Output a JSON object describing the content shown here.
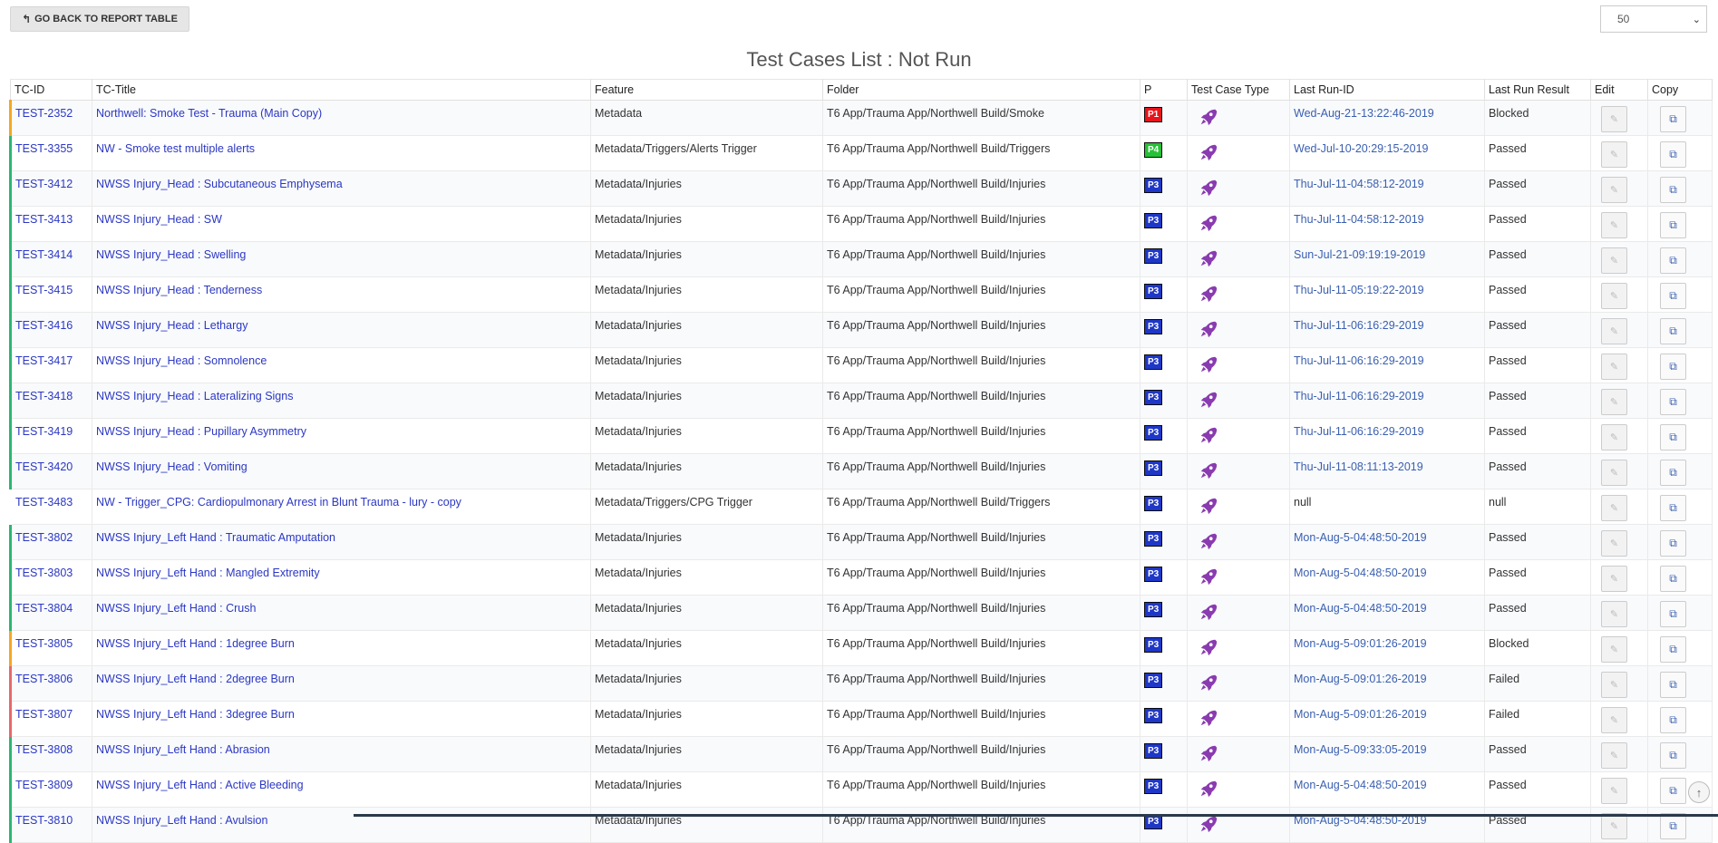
{
  "toolbar": {
    "back_label": "GO BACK TO REPORT TABLE",
    "back_icon": "reply-arrow-icon",
    "page_size_value": "50"
  },
  "page_title": "Test Cases List : Not Run",
  "columns": [
    "TC-ID",
    "TC-Title",
    "Feature",
    "Folder",
    "P",
    "Test Case Type",
    "Last Run-ID",
    "Last Run Result",
    "Edit",
    "Copy"
  ],
  "colors": {
    "link": "#2b37c4",
    "passed_stripe": "#2bb673",
    "blocked_stripe": "#f5a623",
    "failed_stripe": "#e8676b",
    "p1": "#e8141b",
    "p3": "#1f37c7",
    "p4": "#25c136",
    "rocket": "#8a3bb0"
  },
  "rows": [
    {
      "id": "TEST-2352",
      "title": "Northwell: Smoke Test - Trauma (Main Copy)",
      "feature": "Metadata",
      "folder": "T6 App/Trauma App/Northwell Build/Smoke",
      "priority": "P1",
      "last_run_id": "Wed-Aug-21-13:22:46-2019",
      "result": "Blocked"
    },
    {
      "id": "TEST-3355",
      "title": "NW - Smoke test multiple alerts",
      "feature": "Metadata/Triggers/Alerts Trigger",
      "folder": "T6 App/Trauma App/Northwell Build/Triggers",
      "priority": "P4",
      "last_run_id": "Wed-Jul-10-20:29:15-2019",
      "result": "Passed"
    },
    {
      "id": "TEST-3412",
      "title": "NWSS Injury_Head : Subcutaneous Emphysema",
      "feature": "Metadata/Injuries",
      "folder": "T6 App/Trauma App/Northwell Build/Injuries",
      "priority": "P3",
      "last_run_id": "Thu-Jul-11-04:58:12-2019",
      "result": "Passed"
    },
    {
      "id": "TEST-3413",
      "title": "NWSS Injury_Head : SW",
      "feature": "Metadata/Injuries",
      "folder": "T6 App/Trauma App/Northwell Build/Injuries",
      "priority": "P3",
      "last_run_id": "Thu-Jul-11-04:58:12-2019",
      "result": "Passed"
    },
    {
      "id": "TEST-3414",
      "title": "NWSS Injury_Head : Swelling",
      "feature": "Metadata/Injuries",
      "folder": "T6 App/Trauma App/Northwell Build/Injuries",
      "priority": "P3",
      "last_run_id": "Sun-Jul-21-09:19:19-2019",
      "result": "Passed"
    },
    {
      "id": "TEST-3415",
      "title": "NWSS Injury_Head : Tenderness",
      "feature": "Metadata/Injuries",
      "folder": "T6 App/Trauma App/Northwell Build/Injuries",
      "priority": "P3",
      "last_run_id": "Thu-Jul-11-05:19:22-2019",
      "result": "Passed"
    },
    {
      "id": "TEST-3416",
      "title": "NWSS Injury_Head : Lethargy",
      "feature": "Metadata/Injuries",
      "folder": "T6 App/Trauma App/Northwell Build/Injuries",
      "priority": "P3",
      "last_run_id": "Thu-Jul-11-06:16:29-2019",
      "result": "Passed"
    },
    {
      "id": "TEST-3417",
      "title": "NWSS Injury_Head : Somnolence",
      "feature": "Metadata/Injuries",
      "folder": "T6 App/Trauma App/Northwell Build/Injuries",
      "priority": "P3",
      "last_run_id": "Thu-Jul-11-06:16:29-2019",
      "result": "Passed"
    },
    {
      "id": "TEST-3418",
      "title": "NWSS Injury_Head : Lateralizing Signs",
      "feature": "Metadata/Injuries",
      "folder": "T6 App/Trauma App/Northwell Build/Injuries",
      "priority": "P3",
      "last_run_id": "Thu-Jul-11-06:16:29-2019",
      "result": "Passed"
    },
    {
      "id": "TEST-3419",
      "title": "NWSS Injury_Head : Pupillary Asymmetry",
      "feature": "Metadata/Injuries",
      "folder": "T6 App/Trauma App/Northwell Build/Injuries",
      "priority": "P3",
      "last_run_id": "Thu-Jul-11-06:16:29-2019",
      "result": "Passed"
    },
    {
      "id": "TEST-3420",
      "title": "NWSS Injury_Head : Vomiting",
      "feature": "Metadata/Injuries",
      "folder": "T6 App/Trauma App/Northwell Build/Injuries",
      "priority": "P3",
      "last_run_id": "Thu-Jul-11-08:11:13-2019",
      "result": "Passed"
    },
    {
      "id": "TEST-3483",
      "title": "NW - Trigger_CPG: Cardiopulmonary Arrest in Blunt Trauma - lury - copy",
      "feature": "Metadata/Triggers/CPG Trigger",
      "folder": "T6 App/Trauma App/Northwell Build/Triggers",
      "priority": "P3",
      "last_run_id": "null",
      "result": "null"
    },
    {
      "id": "TEST-3802",
      "title": "NWSS Injury_Left Hand : Traumatic Amputation",
      "feature": "Metadata/Injuries",
      "folder": "T6 App/Trauma App/Northwell Build/Injuries",
      "priority": "P3",
      "last_run_id": "Mon-Aug-5-04:48:50-2019",
      "result": "Passed"
    },
    {
      "id": "TEST-3803",
      "title": "NWSS Injury_Left Hand : Mangled Extremity",
      "feature": "Metadata/Injuries",
      "folder": "T6 App/Trauma App/Northwell Build/Injuries",
      "priority": "P3",
      "last_run_id": "Mon-Aug-5-04:48:50-2019",
      "result": "Passed"
    },
    {
      "id": "TEST-3804",
      "title": "NWSS Injury_Left Hand : Crush",
      "feature": "Metadata/Injuries",
      "folder": "T6 App/Trauma App/Northwell Build/Injuries",
      "priority": "P3",
      "last_run_id": "Mon-Aug-5-04:48:50-2019",
      "result": "Passed"
    },
    {
      "id": "TEST-3805",
      "title": "NWSS Injury_Left Hand : 1degree Burn",
      "feature": "Metadata/Injuries",
      "folder": "T6 App/Trauma App/Northwell Build/Injuries",
      "priority": "P3",
      "last_run_id": "Mon-Aug-5-09:01:26-2019",
      "result": "Blocked"
    },
    {
      "id": "TEST-3806",
      "title": "NWSS Injury_Left Hand : 2degree Burn",
      "feature": "Metadata/Injuries",
      "folder": "T6 App/Trauma App/Northwell Build/Injuries",
      "priority": "P3",
      "last_run_id": "Mon-Aug-5-09:01:26-2019",
      "result": "Failed"
    },
    {
      "id": "TEST-3807",
      "title": "NWSS Injury_Left Hand : 3degree Burn",
      "feature": "Metadata/Injuries",
      "folder": "T6 App/Trauma App/Northwell Build/Injuries",
      "priority": "P3",
      "last_run_id": "Mon-Aug-5-09:01:26-2019",
      "result": "Failed"
    },
    {
      "id": "TEST-3808",
      "title": "NWSS Injury_Left Hand : Abrasion",
      "feature": "Metadata/Injuries",
      "folder": "T6 App/Trauma App/Northwell Build/Injuries",
      "priority": "P3",
      "last_run_id": "Mon-Aug-5-09:33:05-2019",
      "result": "Passed"
    },
    {
      "id": "TEST-3809",
      "title": "NWSS Injury_Left Hand : Active Bleeding",
      "feature": "Metadata/Injuries",
      "folder": "T6 App/Trauma App/Northwell Build/Injuries",
      "priority": "P3",
      "last_run_id": "Mon-Aug-5-04:48:50-2019",
      "result": "Passed"
    },
    {
      "id": "TEST-3810",
      "title": "NWSS Injury_Left Hand : Avulsion",
      "feature": "Metadata/Injuries",
      "folder": "T6 App/Trauma App/Northwell Build/Injuries",
      "priority": "P3",
      "last_run_id": "Mon-Aug-5-04:48:50-2019",
      "result": "Passed"
    }
  ]
}
